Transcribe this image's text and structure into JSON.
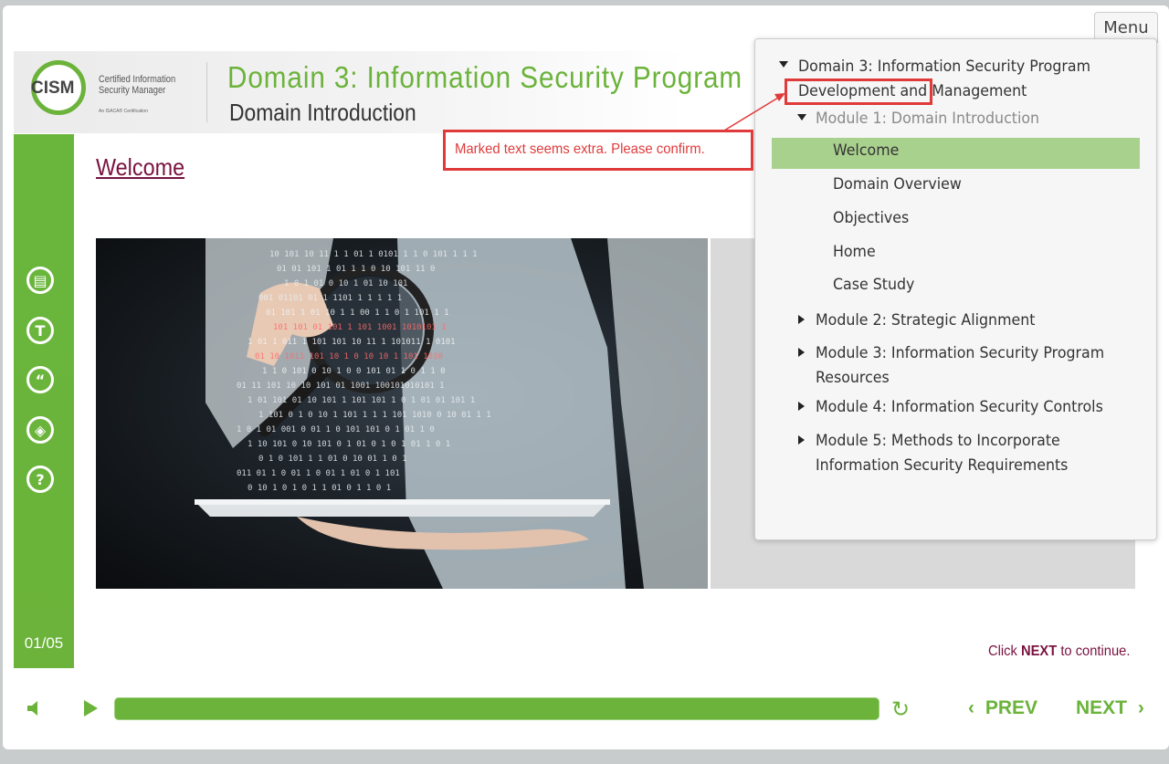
{
  "header": {
    "logo_main": "CISM",
    "logo_line1": "Certified Information",
    "logo_line2": "Security Manager",
    "logo_sub": "An ISACA® Certification",
    "title": "Domain 3: Information Security Program",
    "subtitle": "Domain Introduction"
  },
  "slide": {
    "heading": "Welcome",
    "page_counter": "01/05",
    "next_hint_pre": "Click ",
    "next_hint_bold": "NEXT",
    "next_hint_post": " to continue."
  },
  "sidebar": {
    "icons": [
      "notes-icon",
      "transcript-icon",
      "quote-icon",
      "layers-icon",
      "help-icon"
    ],
    "glyphs": [
      "▤",
      "T",
      "“",
      "◈",
      "?"
    ]
  },
  "controls": {
    "progress": 1.0,
    "prev_label": "PREV",
    "next_label": "NEXT",
    "replay_glyph": "↻",
    "prev_glyph": "‹",
    "next_glyph": "›"
  },
  "menu": {
    "button_label": "Menu",
    "domain_title_1": "Domain 3: Information Security Program",
    "domain_title_2": "Development and Management",
    "module1": "Module 1: Domain Introduction",
    "lessons": [
      "Welcome",
      "Domain Overview",
      "Objectives",
      "Home",
      "Case Study"
    ],
    "module2": "Module 2: Strategic Alignment",
    "module3_1": "Module 3: Information Security Program",
    "module3_2": "Resources",
    "module4": "Module 4: Information Security Controls",
    "module5_1": "Module 5: Methods to Incorporate",
    "module5_2": "Information Security Requirements"
  },
  "annotation": {
    "text": "Marked text seems extra. Please confirm."
  },
  "image": {
    "binary_rows": [
      "10 101 10 11 1 1 01 1 0101 1 1 0 101 1 1 1",
      "01 01 101 1 01 1 1 0 10 101 11 0",
      "1 0 1 01 0 10 1 01 10 101",
      "001 01101 01 1 1101 1 1 1 1 1",
      "01 101 1 01 10 1 1 00 1 1 0 1 101 1 1",
      "101 101 01 101 1 101 1001 1010101 1",
      "1 01 1 011 1 101 101 10 11 1 101011 1 0101",
      "01 10 1011 101 10 1 0 10 10 1 101 1010",
      "1 1 0 101 0 10 1 0 0 101 01 1 0 1 1 0",
      "01 11 101 10 10 101 01 1001 100101010101 1",
      "1 01 101 01 10 101 1 101 101 1 0 1 01 01 101 1",
      "1 101 0 1 0 10 1 101 1 1 1 101 1010 0 10 01 1 1",
      "1 0 1 01 001 0 01 1 0 101 101 0 1 01 1 0",
      "1 10 101 0 10 101 0 1 01 0 1 0 1 01 1 0 1",
      "0 1 0 101 1 1 01 0 10 01 1 0 1",
      "011 01 1 0 01 1 0 01 1 01 0 1 101",
      "0 10 1 0 1 0 1 1 01 0 1 1 0 1"
    ]
  }
}
